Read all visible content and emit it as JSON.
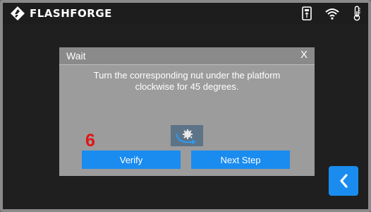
{
  "header": {
    "brand": "FLASHFORGE",
    "icons": [
      "flashforge-logo-icon",
      "usb-icon",
      "wifi-icon",
      "thermometer-icon"
    ]
  },
  "dialog": {
    "title": "Wait",
    "close_label": "X",
    "message_line1": "Turn the corresponding nut under the platform",
    "message_line2": "clockwise for 45 degrees.",
    "illustration": "rotate-clockwise-icon",
    "step_number": "6",
    "verify_label": "Verify",
    "next_label": "Next Step"
  },
  "navigation": {
    "back_icon": "chevron-left-icon"
  },
  "colors": {
    "accent": "#1a8cf0",
    "step_number": "#e21414",
    "topbar": "#1d1d1d",
    "screen": "#1f1f1f",
    "dialog": "#9c9c9c"
  }
}
